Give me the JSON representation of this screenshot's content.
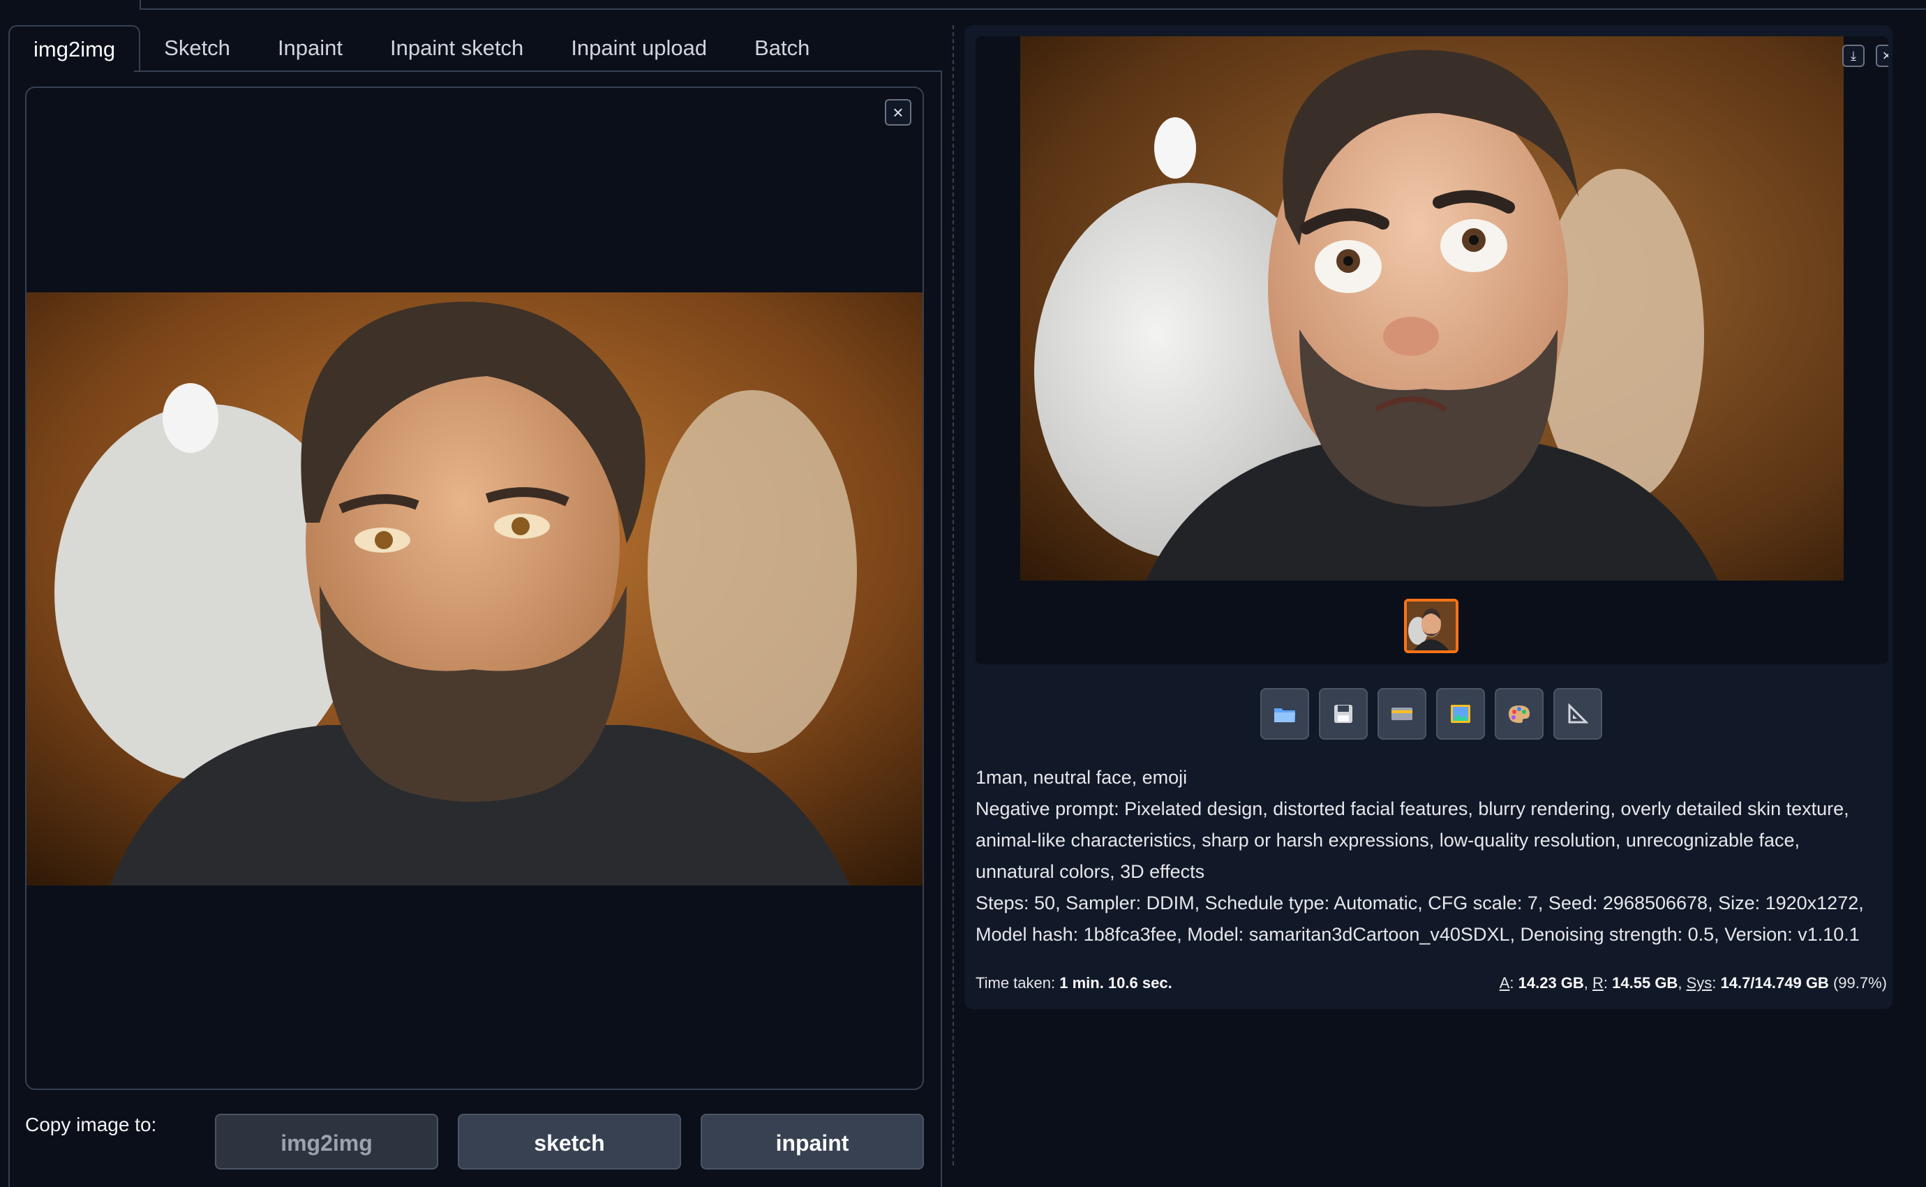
{
  "tabs": [
    {
      "label": "img2img",
      "active": true
    },
    {
      "label": "Sketch"
    },
    {
      "label": "Inpaint"
    },
    {
      "label": "Inpaint sketch"
    },
    {
      "label": "Inpaint upload"
    },
    {
      "label": "Batch"
    }
  ],
  "input_image": {
    "close_icon": "close-icon"
  },
  "copy": {
    "label": "Copy image to:",
    "buttons": [
      {
        "label": "img2img",
        "disabled": true
      },
      {
        "label": "sketch"
      },
      {
        "label": "inpaint"
      }
    ]
  },
  "output": {
    "tools": [
      "open-folder-icon",
      "save-icon",
      "zip-icon",
      "send-to-img2img-icon",
      "send-to-inpaint-icon",
      "send-to-extras-icon"
    ],
    "prompt": "1man, neutral face, emoji",
    "negative": "Negative prompt: Pixelated design, distorted facial features, blurry rendering, overly detailed skin texture, animal-like characteristics, sharp or harsh expressions, low-quality resolution, unrecognizable face, unnatural colors, 3D effects",
    "params": "Steps: 50, Sampler: DDIM, Schedule type: Automatic, CFG scale: 7, Seed: 2968506678, Size: 1920x1272, Model hash: 1b8fca3fee, Model: samaritan3dCartoon_v40SDXL, Denoising strength: 0.5, Version: v1.10.1",
    "time_label": "Time taken:",
    "time_value": "1 min. 10.6 sec.",
    "mem": {
      "a_label": "A",
      "a_value": "14.23 GB",
      "r_label": "R",
      "r_value": "14.55 GB",
      "sys_label": "Sys",
      "sys_value": "14.7/14.749 GB",
      "pct": "(99.7%)"
    }
  },
  "colors": {
    "accent": "#f97316",
    "bg": "#0b0f19",
    "panel": "#111827",
    "button": "#374151"
  }
}
